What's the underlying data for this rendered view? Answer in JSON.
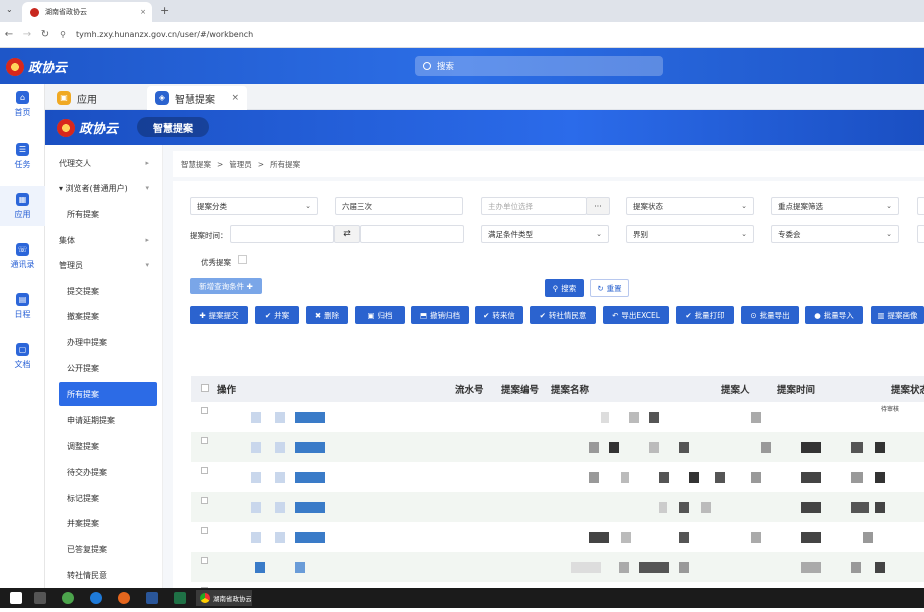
{
  "browser": {
    "tab_title": "湖南省政协云",
    "url": "tymh.zxy.hunanzx.gov.cn/user/#/workbench"
  },
  "header": {
    "logo_text": "政协云",
    "search_placeholder": "搜索"
  },
  "rail": [
    {
      "label": "首页",
      "icon": "home-icon"
    },
    {
      "label": "任务",
      "icon": "task-icon"
    },
    {
      "label": "应用",
      "icon": "apps-icon"
    },
    {
      "label": "通讯录",
      "icon": "contacts-icon"
    },
    {
      "label": "日程",
      "icon": "calendar-icon"
    },
    {
      "label": "文档",
      "icon": "document-icon"
    }
  ],
  "app_tabs": [
    {
      "label": "应用"
    },
    {
      "label": "智慧提案",
      "close": "×"
    }
  ],
  "banner": {
    "logo_text": "政协云",
    "module": "智慧提案"
  },
  "sidebar": [
    {
      "label": "代理交人",
      "chev": "▸"
    },
    {
      "label": "▾ 浏览者(普通用户)",
      "chev": "▾"
    },
    {
      "label": "所有提案"
    },
    {
      "label": "集体",
      "chev": "▸"
    },
    {
      "label": "管理员",
      "chev": "▾"
    },
    {
      "label": "提交提案"
    },
    {
      "label": "撤案提案"
    },
    {
      "label": "办理中提案"
    },
    {
      "label": "公开提案"
    },
    {
      "label": "所有提案"
    },
    {
      "label": "申请延期提案"
    },
    {
      "label": "调整提案"
    },
    {
      "label": "待交办提案"
    },
    {
      "label": "标记提案"
    },
    {
      "label": "并案提案"
    },
    {
      "label": "已答复提案"
    },
    {
      "label": "转社情民意"
    }
  ],
  "breadcrumb": [
    "智慧提案",
    ">",
    "管理员",
    ">",
    "所有提案"
  ],
  "filters": {
    "category": "提案分类",
    "session": "六届三次",
    "unit_placeholder": "主办单位选择",
    "unit_btn": "···",
    "status": "提案状态",
    "key": "重点提案筛选",
    "time_label": "提案时间：",
    "time_swap": "⇄",
    "condition": "满足条件类型",
    "sector": "界别",
    "committee": "专委会",
    "excellent_label": "优秀提案",
    "new_condition": "新增查询条件 ✚"
  },
  "actions": {
    "search": "搜索",
    "reset": "重置",
    "buttons": [
      "提案提交",
      "并案",
      "删除",
      "归档",
      "撤销归档",
      "转来信",
      "转社情民意",
      "导出EXCEL",
      "批量打印",
      "批量导出",
      "批量导入",
      "提案画像"
    ]
  },
  "table": {
    "headers": [
      "操作",
      "流水号",
      "提案编号",
      "提案名称",
      "提案人",
      "提案时间",
      "提案状态"
    ],
    "row_partial_text": "待审核"
  },
  "colors": {
    "brand": "#2b63cf",
    "header": "#1e56c8",
    "active": "#2c6be6"
  }
}
